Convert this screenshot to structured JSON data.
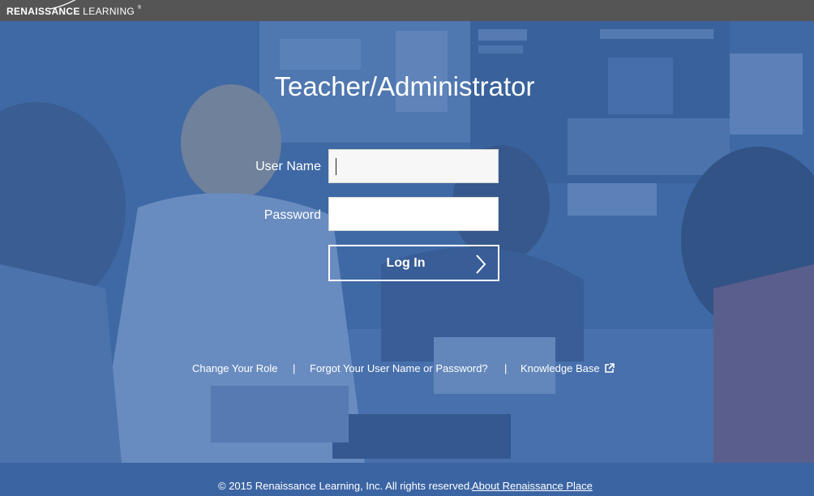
{
  "header": {
    "brand_bold": "RENAISSANCE",
    "brand_light": "LEARNING",
    "brand_mark": "®"
  },
  "login": {
    "title": "Teacher/Administrator",
    "username_label": "User Name",
    "username_value": "",
    "password_label": "Password",
    "password_value": "",
    "login_button_label": "Log In"
  },
  "links": {
    "change_role": "Change Your Role",
    "separator_1": "|",
    "forgot": "Forgot Your User Name or Password?",
    "separator_2": "|",
    "knowledge_base": "Knowledge Base"
  },
  "footer": {
    "copyright": "© 2015 Renaissance Learning, Inc. All rights reserved.",
    "about_link": "About Renaissance Place"
  },
  "colors": {
    "topbar": "#555555",
    "overlay_blue": "#3464a5",
    "footer_blue": "#3b64a3",
    "text": "#ffffff"
  },
  "icons": {
    "login_arrow": "chevron-right-icon",
    "knowledge_base": "external-link-icon"
  }
}
